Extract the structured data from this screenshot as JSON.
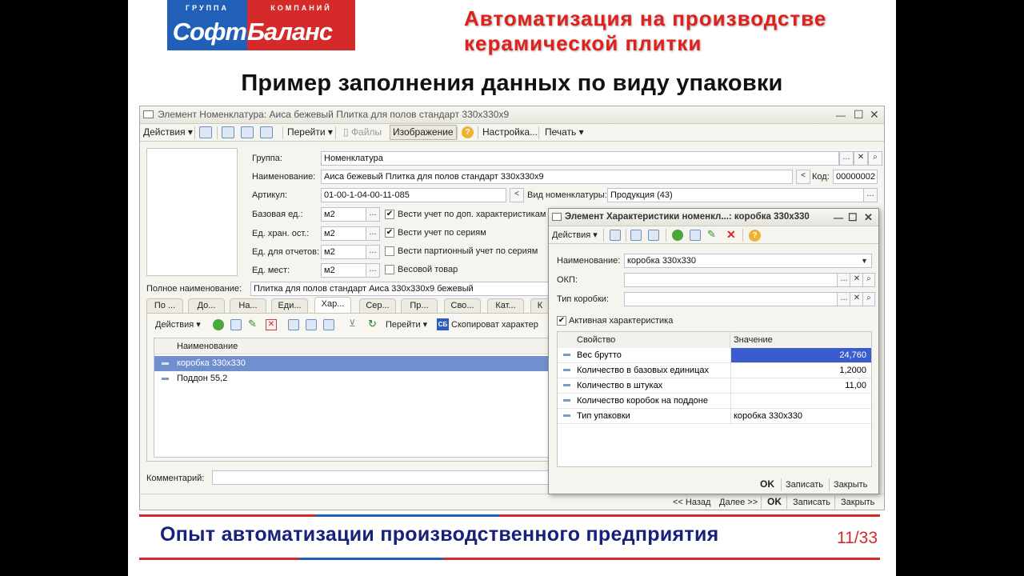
{
  "logo": {
    "top_left": "ГРУППА",
    "top_right": "КОМПАНИЙ",
    "main_left": "Софт",
    "main_right": "Баланс"
  },
  "header_title": [
    "Автоматизация на производстве",
    "керамической плитки"
  ],
  "main_title": "Пример заполнения данных по виду упаковки",
  "window": {
    "title": "Элемент Номенклатура: Аиса бежевый Плитка для полов стандарт 330x330x9",
    "toolbar": {
      "actions": "Действия",
      "goto": "Перейти",
      "files": "Файлы",
      "image": "Изображение",
      "settings": "Настройка...",
      "print": "Печать"
    },
    "labels": {
      "group": "Группа:",
      "name": "Наименование:",
      "code": "Код:",
      "article": "Артикул:",
      "kind": "Вид номенклатуры:",
      "base_unit": "Базовая ед.:",
      "storage_unit": "Ед. хран. ост.:",
      "report_unit": "Ед. для отчетов:",
      "place_unit": "Ед. мест:",
      "full_name": "Полное наименование:",
      "comment": "Комментарий:"
    },
    "values": {
      "group": "Номенклатура",
      "name": "Аиса бежевый Плитка для полов стандарт 330x330x9",
      "code": "00000002",
      "article": "01-00-1-04-00-11-085",
      "kind": "Продукция (43)",
      "base_unit": "м2",
      "storage_unit": "м2",
      "report_unit": "м2",
      "place_unit": "м2",
      "full_name": "Плитка для полов стандарт Аиса 330x330x9 бежевый",
      "comment": ""
    },
    "checkboxes": {
      "extra_chars": "Вести учет по доп. характеристикам",
      "series": "Вести учет по сериям",
      "batch_series": "Вести партионный учет по сериям",
      "weight": "Весовой товар"
    },
    "tabs": [
      "По ...",
      "До...",
      "На...",
      "Еди...",
      "Хар...",
      "Сер...",
      "Пр...",
      "Сво...",
      "Кат...",
      "К"
    ],
    "tab_toolbar": {
      "actions": "Действия",
      "goto": "Перейти",
      "copy": "Скопироват характер"
    },
    "list": {
      "header": "Наименование",
      "rows": [
        "коробка 330x330",
        "Поддон 55,2"
      ]
    },
    "bottom": {
      "back": "<< Назад",
      "next": "Далее >>",
      "ok": "OK",
      "save": "Записать",
      "close": "Закрыть"
    }
  },
  "dialog": {
    "title": "Элемент Характеристики номенкл...: коробка 330x330",
    "toolbar_actions": "Действия",
    "labels": {
      "name": "Наименование:",
      "okp": "ОКП:",
      "box_type": "Тип коробки:"
    },
    "values": {
      "name": "коробка 330x330",
      "okp": "",
      "box_type": ""
    },
    "active_label": "Активная характеристика",
    "grid": {
      "headers": [
        "Свойство",
        "Значение"
      ],
      "rows": [
        {
          "prop": "Вес брутто",
          "value": "24,760"
        },
        {
          "prop": "Количество в базовых единицах",
          "value": "1,2000"
        },
        {
          "prop": "Количество в штуках",
          "value": "11,00"
        },
        {
          "prop": "Количество коробок на поддоне",
          "value": ""
        },
        {
          "prop": "Тип упаковки",
          "value": "коробка 330x330"
        }
      ]
    },
    "footer": {
      "ok": "OK",
      "save": "Записать",
      "close": "Закрыть"
    }
  },
  "footer_text": "Опыт автоматизации производственного предприятия",
  "page": "11/33",
  "colors": {
    "brand_blue": "#2060b8",
    "brand_red": "#d42a2a",
    "selection": "#6f8fcf",
    "value_selection": "#3a5ccf",
    "footer_text": "#17207a"
  }
}
